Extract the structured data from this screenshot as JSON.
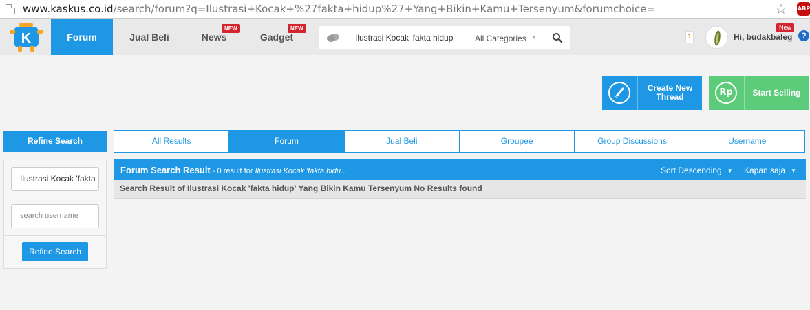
{
  "browser": {
    "url_host": "www.kaskus.co.id",
    "url_path": "/search/forum?q=Ilustrasi+Kocak+%27fakta+hidup%27+Yang+Bikin+Kamu+Tersenyum&forumchoice=",
    "adblock_label": "ABP"
  },
  "nav": {
    "items": [
      {
        "label": "Forum"
      },
      {
        "label": "Jual Beli"
      },
      {
        "label": "News",
        "badge": "NEW"
      },
      {
        "label": "Gadget",
        "badge": "NEW"
      }
    ],
    "search_value": "Ilustrasi Kocak 'fakta hidup'",
    "category": "All Categories",
    "notification_count": "1",
    "greeting": "Hi, budakbaleg",
    "user_badge": "New",
    "help": "?"
  },
  "actions": {
    "create_thread": "Create New Thread",
    "start_selling": "Start Selling",
    "sell_icon_text": "Rp"
  },
  "sidebar": {
    "title": "Refine Search",
    "query_value": "Ilustrasi Kocak 'fakta hidup'",
    "username_placeholder": "search username",
    "button": "Refine Search"
  },
  "tabs": [
    "All Results",
    "Forum",
    "Jual Beli",
    "Groupee",
    "Group Discussions",
    "Username"
  ],
  "results": {
    "title": "Forum Search Result",
    "count": " - 0 result for ",
    "query": "Ilustrasi Kocak 'fakta hidu...",
    "sort": "Sort Descending",
    "time": "Kapan saja",
    "message": "Search Result of Ilustrasi Kocak 'fakta hidup' Yang Bikin Kamu Tersenyum No Results found"
  },
  "colors": {
    "accent": "#1e98e5",
    "sell": "#5ccc7a",
    "badge": "#d3252f"
  }
}
